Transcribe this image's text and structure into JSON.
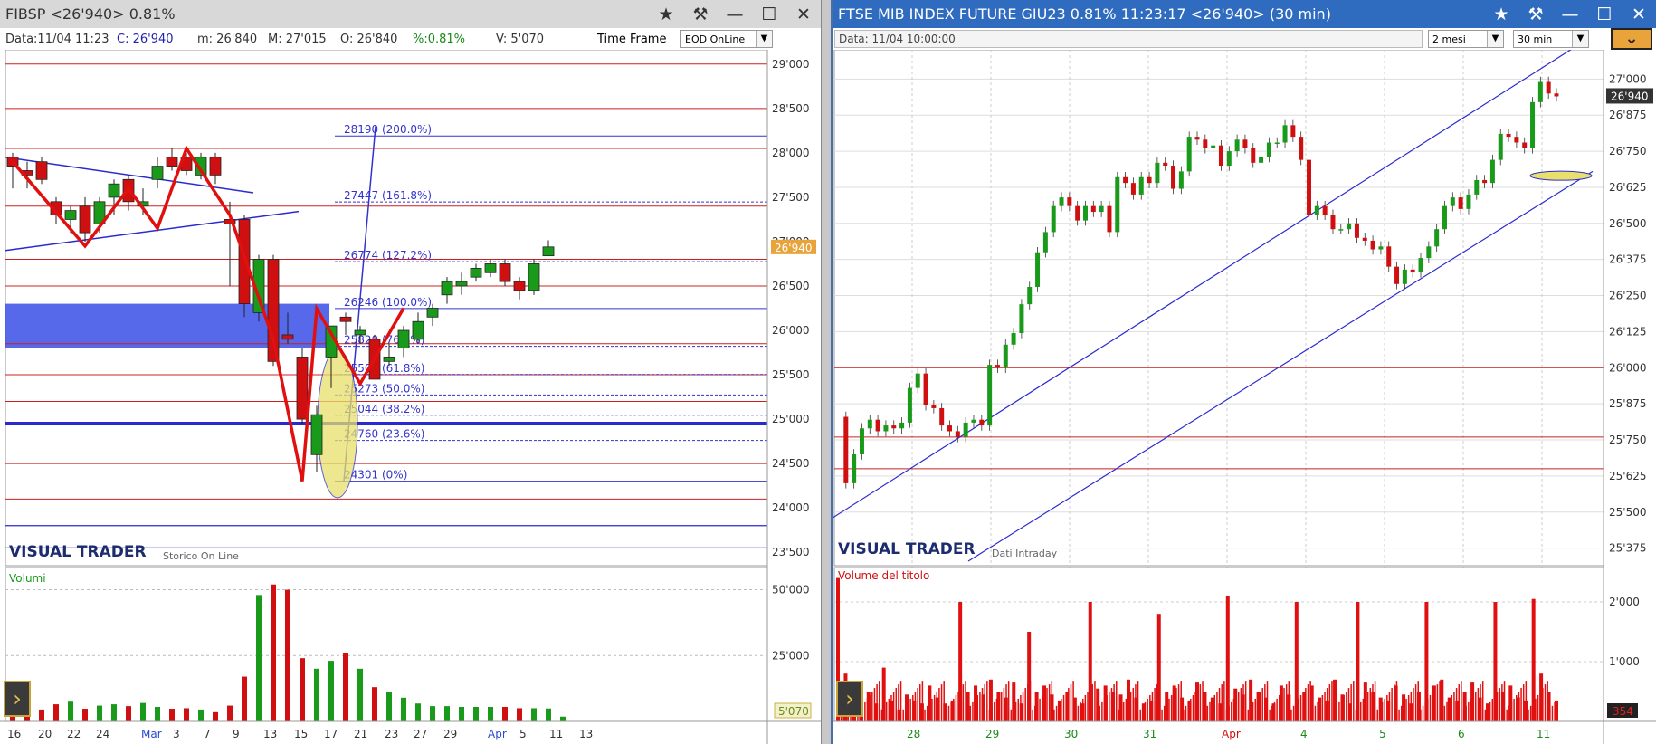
{
  "left": {
    "title": "FIBSP <26'940> 0.81%",
    "info": {
      "data": "Data:11/04 11:23",
      "close": "C: 26'940",
      "min": "m: 26'840",
      "max": "M: 27'015",
      "open": "O: 26'840",
      "pct": "%:0.81%",
      "vol": "V: 5'070",
      "timeframe_label": "Time Frame",
      "timeframe_value": "EOD OnLine"
    },
    "brand": "VISUAL TRADER",
    "brand_sub": "Storico On Line",
    "volume_label": "Volumi",
    "last_price_tag": "26'940",
    "last_volume_tag": "5'070"
  },
  "right": {
    "title": "FTSE MIB INDEX FUTURE GIU23 0.81% 11:23:17  <26'940> (30 min)",
    "info": {
      "data": "Data: 11/04 10:00:00",
      "period_value": "2 mesi",
      "interval_value": "30 min"
    },
    "brand": "VISUAL TRADER",
    "brand_sub": "Dati Intraday",
    "volume_label": "Volume del titolo",
    "last_price_tag": "26'940",
    "last_volume_tag": "354"
  },
  "colors": {
    "up": "#1a9a1a",
    "down": "#d01010",
    "fib": "#3333cc",
    "zigzag": "#e01010",
    "zone": "#3a4fe8",
    "price_tag": "#e8a33a"
  },
  "chart_data": [
    {
      "type": "candlestick",
      "name": "FIBSP daily",
      "x_tick_labels": [
        "16",
        "20",
        "22",
        "24",
        "Mar",
        "3",
        "7",
        "9",
        "13",
        "15",
        "17",
        "21",
        "23",
        "27",
        "29",
        "Apr",
        "5",
        "11",
        "13"
      ],
      "y_tick_labels": [
        "29'000",
        "28'500",
        "28'000",
        "27'500",
        "27'000",
        "26'500",
        "26'000",
        "25'500",
        "25'000",
        "24'500",
        "24'000",
        "23'500"
      ],
      "ylim": [
        23400,
        29100
      ],
      "candles": [
        {
          "o": 27950,
          "h": 28000,
          "l": 27600,
          "c": 27850
        },
        {
          "o": 27800,
          "h": 27900,
          "l": 27600,
          "c": 27750
        },
        {
          "o": 27900,
          "h": 27950,
          "l": 27650,
          "c": 27700
        },
        {
          "o": 27450,
          "h": 27500,
          "l": 27200,
          "c": 27300
        },
        {
          "o": 27250,
          "h": 27400,
          "l": 27100,
          "c": 27350
        },
        {
          "o": 27400,
          "h": 27500,
          "l": 27000,
          "c": 27100
        },
        {
          "o": 27200,
          "h": 27500,
          "l": 27100,
          "c": 27450
        },
        {
          "o": 27500,
          "h": 27700,
          "l": 27300,
          "c": 27650
        },
        {
          "o": 27700,
          "h": 27750,
          "l": 27350,
          "c": 27450
        },
        {
          "o": 27400,
          "h": 27600,
          "l": 27300,
          "c": 27450
        },
        {
          "o": 27700,
          "h": 27950,
          "l": 27600,
          "c": 27850
        },
        {
          "o": 27950,
          "h": 28050,
          "l": 27800,
          "c": 27850
        },
        {
          "o": 27950,
          "h": 28000,
          "l": 27750,
          "c": 27800
        },
        {
          "o": 27750,
          "h": 28000,
          "l": 27700,
          "c": 27950
        },
        {
          "o": 27950,
          "h": 28000,
          "l": 27650,
          "c": 27750
        },
        {
          "o": 27250,
          "h": 27450,
          "l": 26500,
          "c": 27200
        },
        {
          "o": 27250,
          "h": 27300,
          "l": 26150,
          "c": 26300
        },
        {
          "o": 26200,
          "h": 26850,
          "l": 26100,
          "c": 26800
        },
        {
          "o": 26800,
          "h": 26850,
          "l": 25600,
          "c": 25650
        },
        {
          "o": 25950,
          "h": 26200,
          "l": 25850,
          "c": 25900
        },
        {
          "o": 25700,
          "h": 25800,
          "l": 24950,
          "c": 25000
        },
        {
          "o": 24600,
          "h": 25150,
          "l": 24400,
          "c": 25050
        },
        {
          "o": 25700,
          "h": 26050,
          "l": 25350,
          "c": 26050
        },
        {
          "o": 26150,
          "h": 26200,
          "l": 25950,
          "c": 26100
        },
        {
          "o": 25950,
          "h": 26050,
          "l": 25850,
          "c": 26000
        },
        {
          "o": 25900,
          "h": 25950,
          "l": 25450,
          "c": 25450
        },
        {
          "o": 25650,
          "h": 25850,
          "l": 25600,
          "c": 25700
        },
        {
          "o": 25800,
          "h": 26050,
          "l": 25700,
          "c": 26000
        },
        {
          "o": 25900,
          "h": 26200,
          "l": 25850,
          "c": 26100
        },
        {
          "o": 26150,
          "h": 26300,
          "l": 26050,
          "c": 26250
        },
        {
          "o": 26400,
          "h": 26600,
          "l": 26300,
          "c": 26550
        },
        {
          "o": 26500,
          "h": 26650,
          "l": 26400,
          "c": 26550
        },
        {
          "o": 26600,
          "h": 26750,
          "l": 26550,
          "c": 26700
        },
        {
          "o": 26650,
          "h": 26800,
          "l": 26600,
          "c": 26750
        },
        {
          "o": 26750,
          "h": 26800,
          "l": 26500,
          "c": 26550
        },
        {
          "o": 26550,
          "h": 26600,
          "l": 26350,
          "c": 26450
        },
        {
          "o": 26450,
          "h": 26800,
          "l": 26400,
          "c": 26750
        },
        {
          "o": 26840,
          "h": 27015,
          "l": 26840,
          "c": 26940
        }
      ],
      "fibonacci_levels": [
        {
          "label": "28190 (200.0%)",
          "value": 28190
        },
        {
          "label": "27447 (161.8%)",
          "value": 27447
        },
        {
          "label": "26774 (127.2%)",
          "value": 26774
        },
        {
          "label": "26246 (100.0%)",
          "value": 26246
        },
        {
          "label": "25820 (76.4%)",
          "value": 25820
        },
        {
          "label": "25503 (61.8%)",
          "value": 25503
        },
        {
          "label": "25273 (50.0%)",
          "value": 25273
        },
        {
          "label": "25044 (38.2%)",
          "value": 25044
        },
        {
          "label": "24760 (23.6%)",
          "value": 24760
        },
        {
          "label": "24301 (0%)",
          "value": 24301
        }
      ],
      "horizontal_lines_red": [
        29000,
        28500,
        28050,
        27400,
        26800,
        26500,
        25850,
        25500,
        25200,
        24500,
        24100
      ],
      "horizontal_lines_blue": [
        24950,
        23800,
        23550
      ],
      "support_zone": [
        25800,
        26300
      ],
      "volumes": [
        7000,
        6500,
        4500,
        6500,
        7500,
        4800,
        6000,
        6500,
        5800,
        7000,
        5500,
        4800,
        5000,
        4500,
        3500,
        6000,
        17000,
        48000,
        52000,
        50000,
        24000,
        20000,
        23000,
        26000,
        20000,
        13000,
        11000,
        9000,
        6800,
        5800,
        5800,
        5500,
        5500,
        5500,
        5500,
        5000,
        5000,
        4900,
        1800
      ],
      "volume_tick_labels": [
        "50'000",
        "25'000"
      ]
    },
    {
      "type": "candlestick",
      "name": "FTSE MIB INDEX FUTURE GIU23 30 min",
      "x_tick_labels": [
        "28",
        "29",
        "30",
        "31",
        "Apr",
        "4",
        "5",
        "6",
        "11"
      ],
      "y_tick_labels": [
        "27'000",
        "26'875",
        "26'750",
        "26'625",
        "26'500",
        "26'375",
        "26'250",
        "26'125",
        "26'000",
        "25'875",
        "25'750",
        "25'625",
        "25'500",
        "25'375"
      ],
      "ylim": [
        25330,
        27070
      ],
      "horizontal_lines_red": [
        26000,
        25760,
        25650
      ],
      "volume_tick_labels": [
        "2'000",
        "1'000"
      ],
      "price_path": [
        25830,
        25600,
        25700,
        25790,
        25820,
        25780,
        25800,
        25790,
        25810,
        25930,
        25980,
        25870,
        25860,
        25800,
        25780,
        25760,
        25810,
        25820,
        25800,
        26010,
        26000,
        26080,
        26120,
        26220,
        26280,
        26400,
        26470,
        26560,
        26590,
        26560,
        26510,
        26560,
        26540,
        26560,
        26470,
        26660,
        26640,
        26600,
        26660,
        26640,
        26710,
        26700,
        26620,
        26680,
        26800,
        26790,
        26760,
        26770,
        26700,
        26750,
        26790,
        26760,
        26710,
        26730,
        26780,
        26780,
        26840,
        26800,
        26720,
        26530,
        26560,
        26530,
        26480,
        26480,
        26500,
        26450,
        26440,
        26410,
        26420,
        26350,
        26290,
        26340,
        26330,
        26380,
        26420,
        26480,
        26560,
        26590,
        26550,
        26600,
        26650,
        26640,
        26720,
        26810,
        26800,
        26780,
        26760,
        26920,
        26990,
        26950,
        26940
      ],
      "volumes": [
        2400,
        800,
        600,
        400,
        500,
        300,
        900,
        350,
        200,
        450,
        350,
        300,
        600,
        400,
        300,
        350,
        2000,
        500,
        600,
        450,
        700,
        500,
        400,
        650,
        300,
        1500,
        500,
        600,
        450,
        350,
        500,
        400,
        300,
        2000,
        550,
        600,
        500,
        450,
        700,
        400,
        300,
        350,
        1800,
        500,
        600,
        400,
        350,
        650,
        500,
        400,
        300,
        2100,
        550,
        450,
        700,
        500,
        400,
        300,
        600,
        450,
        2000,
        500,
        600,
        400,
        350,
        700,
        450,
        300,
        2000,
        650,
        500,
        400,
        350,
        600,
        450,
        300,
        500,
        2000,
        600,
        700,
        400,
        350,
        500,
        650,
        400,
        300,
        2000,
        500,
        600,
        400,
        350,
        2050,
        800,
        500,
        350
      ]
    }
  ]
}
